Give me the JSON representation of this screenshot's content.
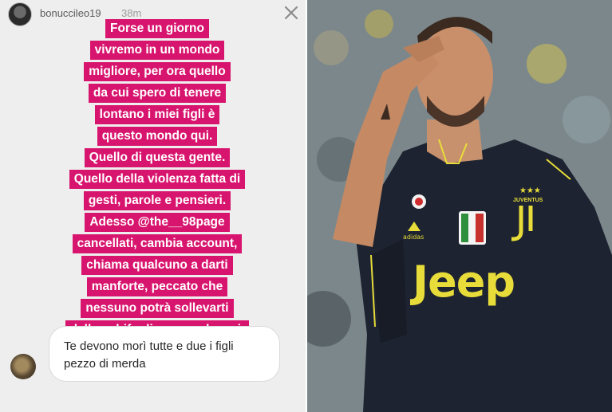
{
  "story": {
    "username": "bonuccileo19",
    "time": "38m",
    "caption_lines": [
      "Forse un giorno",
      "vivremo in un mondo",
      "migliore, per ora quello",
      "da cui spero di tenere",
      "lontano i miei figli è",
      "questo mondo qui.",
      "Quello di questa gente.",
      "Quello della violenza fatta di",
      "gesti, parole e pensieri.",
      "Adesso @the__98page",
      "cancellati, cambia account,",
      "chiama qualcuno a darti",
      "manforte, peccato che",
      "nessuno potrà sollevarti",
      "dallo schifo di essere che sei."
    ],
    "caption_bg": "#d8156e",
    "reply": {
      "line1": "Te devono morì tutte e due i figli",
      "line2": "pezzo di merda"
    },
    "close_icon": "close-icon"
  },
  "photo": {
    "jersey_sponsor": "Jeep",
    "club_text": "JUVENTUS",
    "jersey_color": "#1d2330",
    "accent_color": "#e8dc3a"
  }
}
